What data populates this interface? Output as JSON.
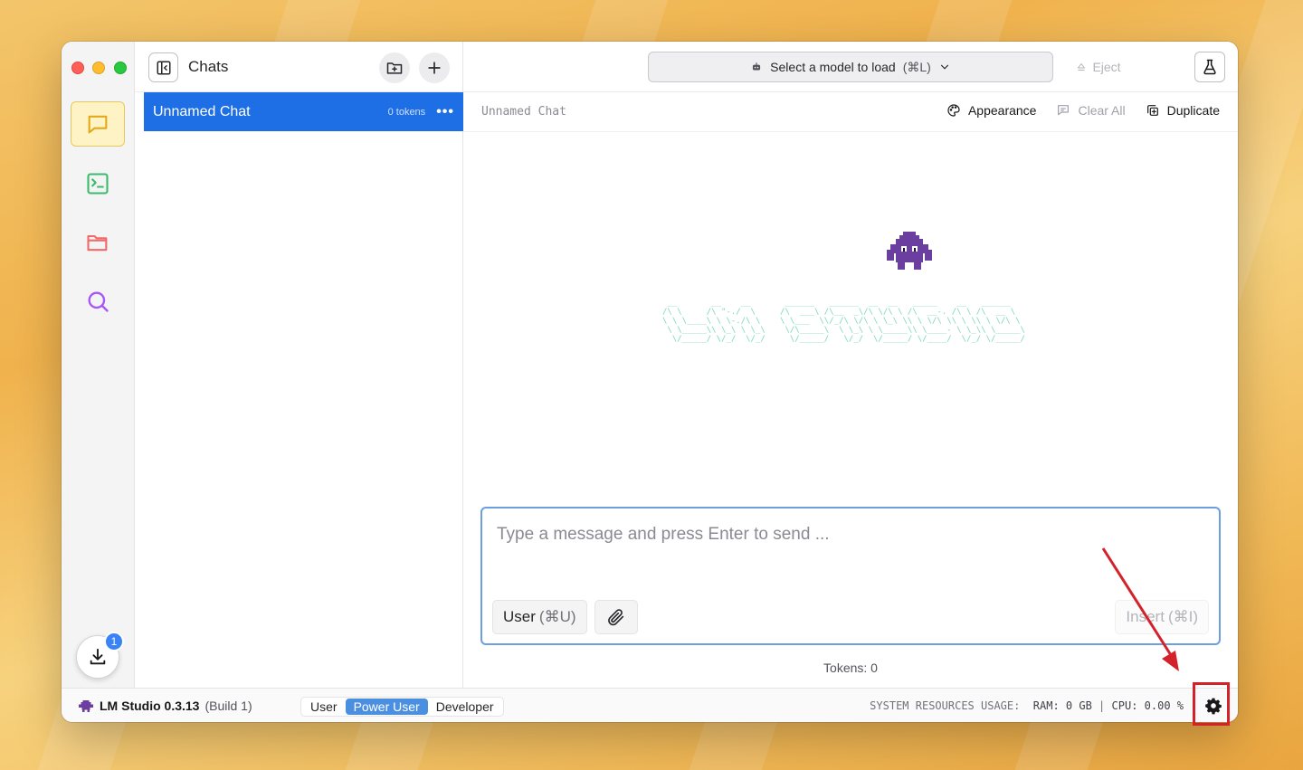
{
  "app": {
    "name": "LM Studio 0.3.13",
    "build": "(Build 1)"
  },
  "rail": {
    "items": [
      {
        "name": "chat",
        "icon": "chat-bubble-icon",
        "color": "#e2a91a",
        "active": true
      },
      {
        "name": "developer",
        "icon": "terminal-icon",
        "color": "#3cba6b",
        "active": false
      },
      {
        "name": "my-models",
        "icon": "folder-icon",
        "color": "#ef6a6a",
        "active": false
      },
      {
        "name": "discover",
        "icon": "search-icon",
        "color": "#a855f7",
        "active": false
      }
    ],
    "downloads_badge": "1"
  },
  "chats": {
    "title": "Chats",
    "items": [
      {
        "name": "Unnamed Chat",
        "tokens": "0 tokens"
      }
    ]
  },
  "topbar": {
    "model_select_label": "Select a model to load",
    "model_select_shortcut": "(⌘L)",
    "eject_label": "Eject"
  },
  "subbar": {
    "chat_title": "Unnamed Chat",
    "appearance_label": "Appearance",
    "clear_all_label": "Clear All",
    "duplicate_label": "Duplicate"
  },
  "composer": {
    "placeholder": "Type a message and press Enter to send ...",
    "role_label": "User",
    "role_shortcut": "(⌘U)",
    "insert_label": "Insert",
    "insert_shortcut": "(⌘I)"
  },
  "tokens_text": "Tokens: 0",
  "status": {
    "modes": [
      "User",
      "Power User",
      "Developer"
    ],
    "active_mode": "Power User",
    "usage_label": "SYSTEM RESOURCES USAGE:",
    "ram": "RAM: 0 GB",
    "cpu": "CPU: 0.00 %"
  },
  "colors": {
    "accent": "#1e6ee6",
    "annotation": "#d3222a",
    "mascot": "#6b3fa0"
  }
}
